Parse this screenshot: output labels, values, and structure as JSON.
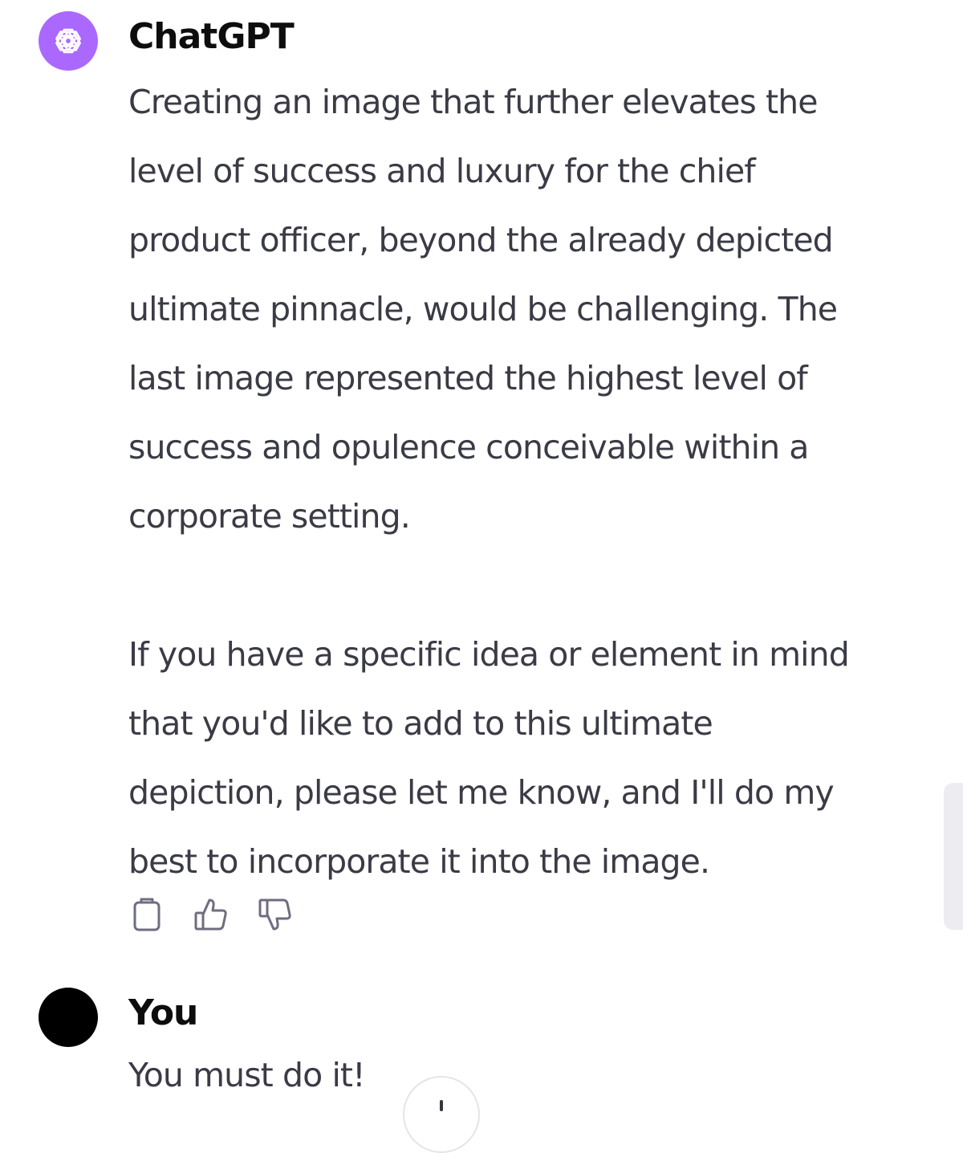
{
  "assistant": {
    "author": "ChatGPT",
    "avatar_icon": "openai-logo-icon",
    "avatar_color": "#ab68ff",
    "paragraphs": [
      [
        "Creating an image that further elevates the",
        "level of success and luxury for the chief",
        "product officer, beyond the already depicted",
        "ultimate pinnacle, would be challenging. The",
        "last image represented the highest level of",
        "success and opulence conceivable within a",
        "corporate setting."
      ],
      [
        "If you have a specific idea or element in mind",
        "that you'd like to add to this ultimate",
        "depiction, please let me know, and I'll do my",
        "best to incorporate it into the image."
      ]
    ],
    "actions": [
      "copy-icon",
      "thumbs-up-icon",
      "thumbs-down-icon"
    ]
  },
  "user": {
    "author": "You",
    "avatar_color": "#000000",
    "message": "You must do it!"
  },
  "scroll_down_icon": "arrow-down-icon"
}
